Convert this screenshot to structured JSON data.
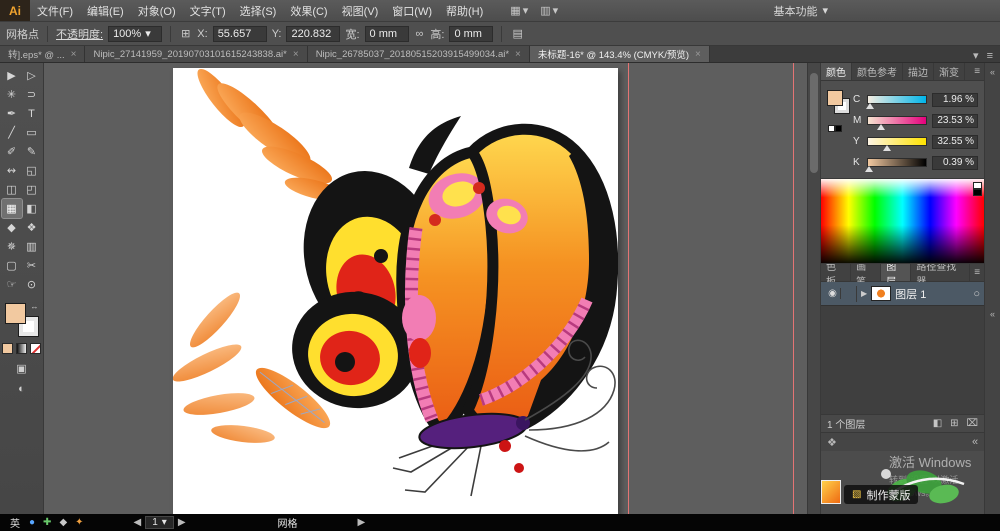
{
  "app": {
    "logo_text": "Ai",
    "workspace_label": "基本功能"
  },
  "menubar": {
    "items": [
      "文件(F)",
      "编辑(E)",
      "对象(O)",
      "文字(T)",
      "选择(S)",
      "效果(C)",
      "视图(V)",
      "窗口(W)",
      "帮助(H)"
    ]
  },
  "controlbar": {
    "context_label": "网格点",
    "opacity_label": "不透明度:",
    "opacity_value": "100%",
    "x_label": "X:",
    "x_value": "55.657",
    "y_label": "Y:",
    "y_value": "220.832",
    "w_label": "宽:",
    "w_value": "0 mm",
    "h_label": "高:",
    "h_value": "0 mm"
  },
  "tabs": {
    "items": [
      {
        "label": "转].eps* @ ..."
      },
      {
        "label": "Nipic_27141959_20190703101615243838.ai*"
      },
      {
        "label": "Nipic_26785037_20180515203915499034.ai*"
      },
      {
        "label": "未标题-16* @ 143.4% (CMYK/预览)"
      }
    ]
  },
  "toolbar": {
    "tools": [
      {
        "name": "selection",
        "g": "▶"
      },
      {
        "name": "direct-selection",
        "g": "▷"
      },
      {
        "name": "magic-wand",
        "g": "✳"
      },
      {
        "name": "lasso",
        "g": "⊃"
      },
      {
        "name": "pen",
        "g": "✒"
      },
      {
        "name": "type",
        "g": "T"
      },
      {
        "name": "line",
        "g": "╱"
      },
      {
        "name": "rectangle",
        "g": "▭"
      },
      {
        "name": "paintbrush",
        "g": "✐"
      },
      {
        "name": "pencil",
        "g": "✎"
      },
      {
        "name": "width",
        "g": "↭"
      },
      {
        "name": "free-transform",
        "g": "◱"
      },
      {
        "name": "shape-builder",
        "g": "◫"
      },
      {
        "name": "perspective-grid",
        "g": "◰"
      },
      {
        "name": "mesh",
        "g": "▦"
      },
      {
        "name": "gradient",
        "g": "◧"
      },
      {
        "name": "eyedropper",
        "g": "◆"
      },
      {
        "name": "blend",
        "g": "❖"
      },
      {
        "name": "symbol-sprayer",
        "g": "✵"
      },
      {
        "name": "column-graph",
        "g": "▥"
      },
      {
        "name": "artboard",
        "g": "▢"
      },
      {
        "name": "slice",
        "g": "✂"
      },
      {
        "name": "hand",
        "g": "☞"
      },
      {
        "name": "zoom",
        "g": "⊙"
      }
    ]
  },
  "colors": {
    "fill_swatch": "#f2c9a0",
    "accent_pink": "#f27db4",
    "guide_red": "#fc7878",
    "body_purple": "#55207d"
  },
  "panels": {
    "color": {
      "tabs": [
        "颜色",
        "颜色参考",
        "描边",
        "渐变"
      ],
      "sliders": [
        {
          "label": "C",
          "value": "1.96 %"
        },
        {
          "label": "M",
          "value": "23.53 %"
        },
        {
          "label": "Y",
          "value": "32.55 %"
        },
        {
          "label": "K",
          "value": "0.39 %"
        }
      ]
    },
    "dock": {
      "tabs": [
        "色板",
        "画笔",
        "图层",
        "路径查找器"
      ]
    },
    "layers": {
      "rows": [
        {
          "name": "图层 1"
        }
      ],
      "footer": "1 个图层"
    }
  },
  "statusbar": {
    "language": "英",
    "artboard_value": "1",
    "tool_label": "网格"
  },
  "overlays": {
    "mask_chip": "制作蒙版",
    "activate_line1": "激活 Windows",
    "activate_line2": "转到\"设置\"以激活 Windows。"
  },
  "icons": {
    "close": "×",
    "dropdown": "▾",
    "menu": "≡",
    "prev": "◀",
    "next": "▶",
    "expand": "▶",
    "eye": "◉",
    "target": "○",
    "collapse": "«",
    "arrange": "▦",
    "layout": "▥",
    "refpoint": "⊞",
    "link": "∞",
    "options": "▤",
    "clip": "◧",
    "newlayer": "⊞",
    "trash": "⌧",
    "swap": "↔",
    "drawmode": "▣",
    "screenmode": "◐",
    "mask": "▧",
    "panel": "❖",
    "app1": "●",
    "app2": "✚",
    "app3": "◆",
    "app4": "✦"
  }
}
